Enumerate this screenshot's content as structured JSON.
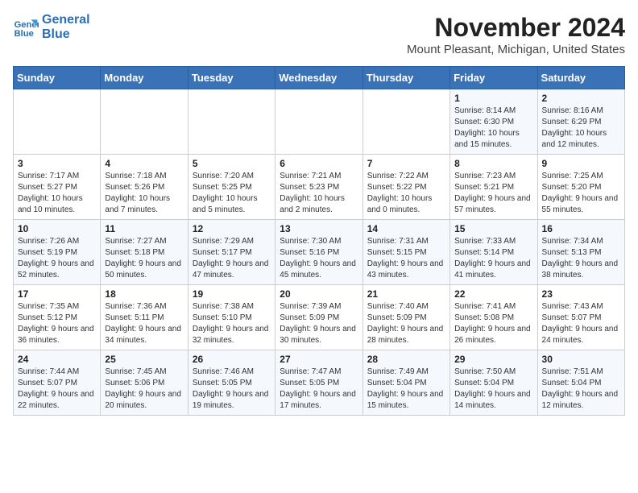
{
  "header": {
    "logo_line1": "General",
    "logo_line2": "Blue",
    "title": "November 2024",
    "subtitle": "Mount Pleasant, Michigan, United States"
  },
  "weekdays": [
    "Sunday",
    "Monday",
    "Tuesday",
    "Wednesday",
    "Thursday",
    "Friday",
    "Saturday"
  ],
  "weeks": [
    [
      {
        "day": "",
        "info": ""
      },
      {
        "day": "",
        "info": ""
      },
      {
        "day": "",
        "info": ""
      },
      {
        "day": "",
        "info": ""
      },
      {
        "day": "",
        "info": ""
      },
      {
        "day": "1",
        "info": "Sunrise: 8:14 AM\nSunset: 6:30 PM\nDaylight: 10 hours and 15 minutes."
      },
      {
        "day": "2",
        "info": "Sunrise: 8:16 AM\nSunset: 6:29 PM\nDaylight: 10 hours and 12 minutes."
      }
    ],
    [
      {
        "day": "3",
        "info": "Sunrise: 7:17 AM\nSunset: 5:27 PM\nDaylight: 10 hours and 10 minutes."
      },
      {
        "day": "4",
        "info": "Sunrise: 7:18 AM\nSunset: 5:26 PM\nDaylight: 10 hours and 7 minutes."
      },
      {
        "day": "5",
        "info": "Sunrise: 7:20 AM\nSunset: 5:25 PM\nDaylight: 10 hours and 5 minutes."
      },
      {
        "day": "6",
        "info": "Sunrise: 7:21 AM\nSunset: 5:23 PM\nDaylight: 10 hours and 2 minutes."
      },
      {
        "day": "7",
        "info": "Sunrise: 7:22 AM\nSunset: 5:22 PM\nDaylight: 10 hours and 0 minutes."
      },
      {
        "day": "8",
        "info": "Sunrise: 7:23 AM\nSunset: 5:21 PM\nDaylight: 9 hours and 57 minutes."
      },
      {
        "day": "9",
        "info": "Sunrise: 7:25 AM\nSunset: 5:20 PM\nDaylight: 9 hours and 55 minutes."
      }
    ],
    [
      {
        "day": "10",
        "info": "Sunrise: 7:26 AM\nSunset: 5:19 PM\nDaylight: 9 hours and 52 minutes."
      },
      {
        "day": "11",
        "info": "Sunrise: 7:27 AM\nSunset: 5:18 PM\nDaylight: 9 hours and 50 minutes."
      },
      {
        "day": "12",
        "info": "Sunrise: 7:29 AM\nSunset: 5:17 PM\nDaylight: 9 hours and 47 minutes."
      },
      {
        "day": "13",
        "info": "Sunrise: 7:30 AM\nSunset: 5:16 PM\nDaylight: 9 hours and 45 minutes."
      },
      {
        "day": "14",
        "info": "Sunrise: 7:31 AM\nSunset: 5:15 PM\nDaylight: 9 hours and 43 minutes."
      },
      {
        "day": "15",
        "info": "Sunrise: 7:33 AM\nSunset: 5:14 PM\nDaylight: 9 hours and 41 minutes."
      },
      {
        "day": "16",
        "info": "Sunrise: 7:34 AM\nSunset: 5:13 PM\nDaylight: 9 hours and 38 minutes."
      }
    ],
    [
      {
        "day": "17",
        "info": "Sunrise: 7:35 AM\nSunset: 5:12 PM\nDaylight: 9 hours and 36 minutes."
      },
      {
        "day": "18",
        "info": "Sunrise: 7:36 AM\nSunset: 5:11 PM\nDaylight: 9 hours and 34 minutes."
      },
      {
        "day": "19",
        "info": "Sunrise: 7:38 AM\nSunset: 5:10 PM\nDaylight: 9 hours and 32 minutes."
      },
      {
        "day": "20",
        "info": "Sunrise: 7:39 AM\nSunset: 5:09 PM\nDaylight: 9 hours and 30 minutes."
      },
      {
        "day": "21",
        "info": "Sunrise: 7:40 AM\nSunset: 5:09 PM\nDaylight: 9 hours and 28 minutes."
      },
      {
        "day": "22",
        "info": "Sunrise: 7:41 AM\nSunset: 5:08 PM\nDaylight: 9 hours and 26 minutes."
      },
      {
        "day": "23",
        "info": "Sunrise: 7:43 AM\nSunset: 5:07 PM\nDaylight: 9 hours and 24 minutes."
      }
    ],
    [
      {
        "day": "24",
        "info": "Sunrise: 7:44 AM\nSunset: 5:07 PM\nDaylight: 9 hours and 22 minutes."
      },
      {
        "day": "25",
        "info": "Sunrise: 7:45 AM\nSunset: 5:06 PM\nDaylight: 9 hours and 20 minutes."
      },
      {
        "day": "26",
        "info": "Sunrise: 7:46 AM\nSunset: 5:05 PM\nDaylight: 9 hours and 19 minutes."
      },
      {
        "day": "27",
        "info": "Sunrise: 7:47 AM\nSunset: 5:05 PM\nDaylight: 9 hours and 17 minutes."
      },
      {
        "day": "28",
        "info": "Sunrise: 7:49 AM\nSunset: 5:04 PM\nDaylight: 9 hours and 15 minutes."
      },
      {
        "day": "29",
        "info": "Sunrise: 7:50 AM\nSunset: 5:04 PM\nDaylight: 9 hours and 14 minutes."
      },
      {
        "day": "30",
        "info": "Sunrise: 7:51 AM\nSunset: 5:04 PM\nDaylight: 9 hours and 12 minutes."
      }
    ]
  ]
}
